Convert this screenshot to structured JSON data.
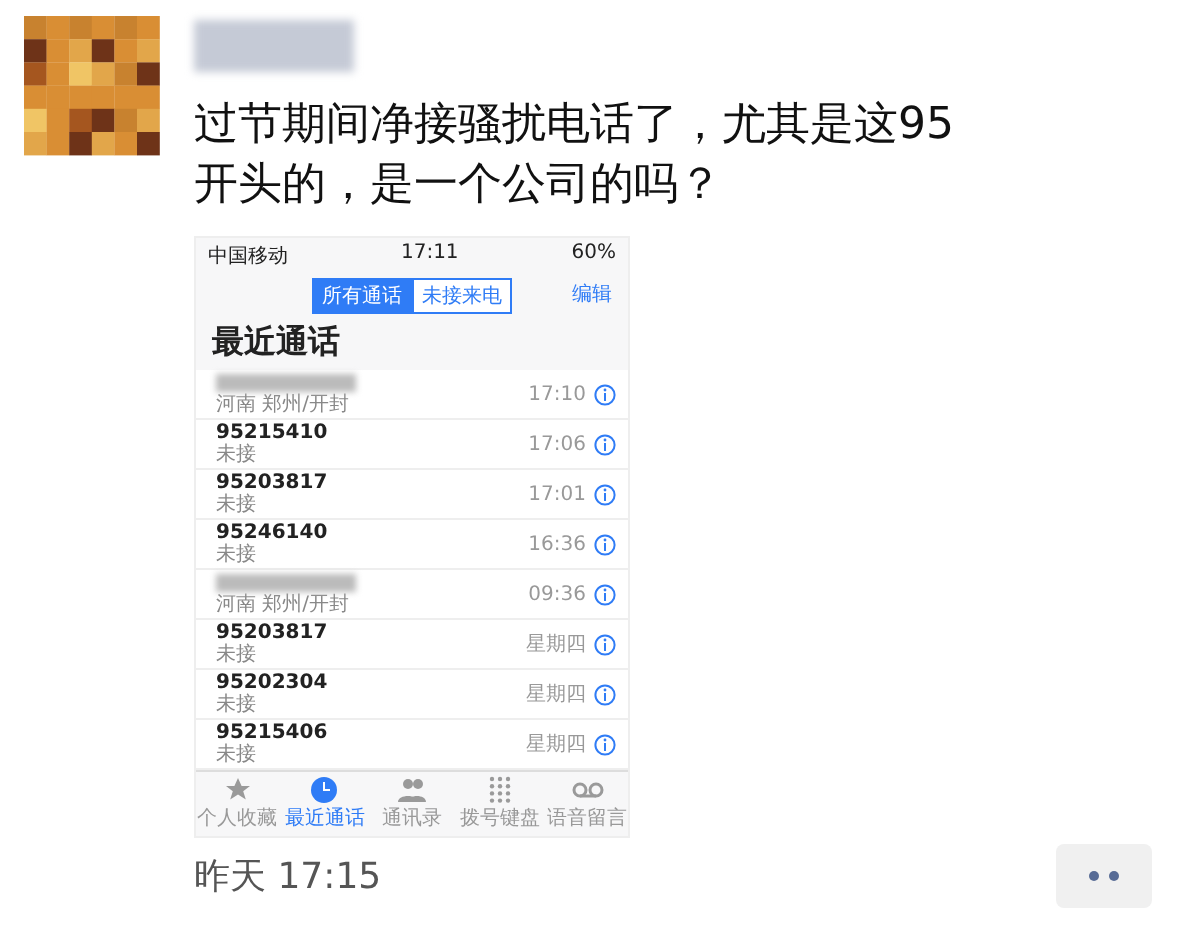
{
  "post": {
    "text": "过节期间净接骚扰电话了，尤其是这95开头的，是一个公司的吗？",
    "time": "昨天 17:15"
  },
  "phone": {
    "status": {
      "carrier": "中国移动",
      "time": "17:11",
      "battery": "60%"
    },
    "segments": [
      {
        "label": "所有通话",
        "selected": true
      },
      {
        "label": "未接来电",
        "selected": false
      }
    ],
    "edit": "编辑",
    "title": "最近通话",
    "calls": [
      {
        "kind": "blurred",
        "label": "河南 郑州/开封",
        "time": "17:10"
      },
      {
        "kind": "number",
        "number": "95215410",
        "label": "未接",
        "time": "17:06"
      },
      {
        "kind": "number",
        "number": "95203817",
        "label": "未接",
        "time": "17:01"
      },
      {
        "kind": "number",
        "number": "95246140",
        "label": "未接",
        "time": "16:36"
      },
      {
        "kind": "blurred",
        "label": "河南 郑州/开封",
        "time": "09:36"
      },
      {
        "kind": "number",
        "number": "95203817",
        "label": "未接",
        "time": "星期四"
      },
      {
        "kind": "number",
        "number": "95202304",
        "label": "未接",
        "time": "星期四"
      },
      {
        "kind": "number",
        "number": "95215406",
        "label": "未接",
        "time": "星期四"
      }
    ],
    "tabs": [
      {
        "kind": "star",
        "label": "个人收藏",
        "selected": false
      },
      {
        "kind": "clock",
        "label": "最近通话",
        "selected": true
      },
      {
        "kind": "people",
        "label": "通讯录",
        "selected": false
      },
      {
        "kind": "keypad",
        "label": "拨号键盘",
        "selected": false
      },
      {
        "kind": "voicemail",
        "label": "语音留言",
        "selected": false
      }
    ]
  }
}
